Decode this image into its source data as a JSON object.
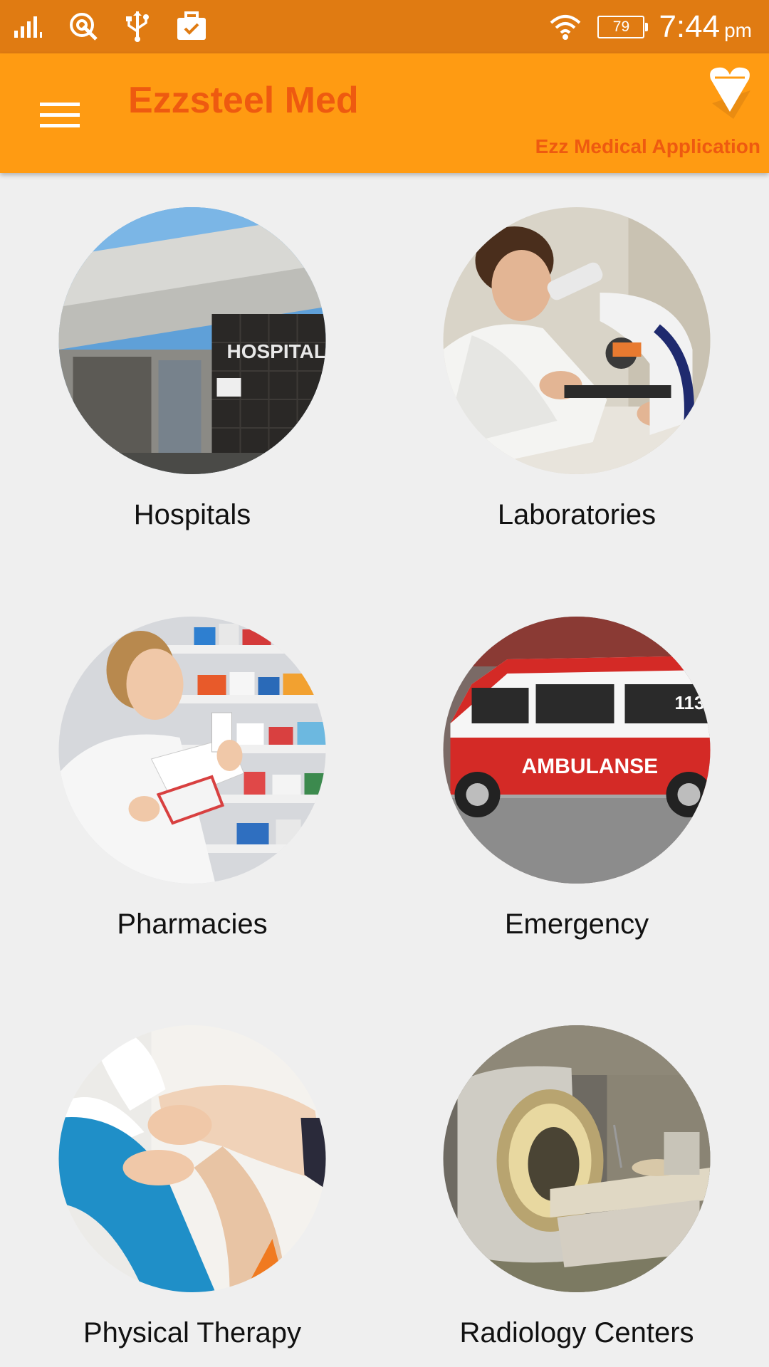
{
  "status_bar": {
    "battery": "79",
    "time": "7:44",
    "ampm": "pm",
    "icons": [
      "signal-icon",
      "location-icon",
      "usb-icon",
      "work-briefcase-icon",
      "wifi-icon",
      "battery-icon"
    ]
  },
  "app_bar": {
    "title": "Ezzsteel Med",
    "subtitle": "Ezz Medical Application",
    "menu_icon": "hamburger-icon",
    "logo_icon": "heart-logo-icon"
  },
  "categories": [
    {
      "label": "Hospitals",
      "icon": "hospital-image"
    },
    {
      "label": "Laboratories",
      "icon": "laboratory-image"
    },
    {
      "label": "Pharmacies",
      "icon": "pharmacy-image"
    },
    {
      "label": "Emergency",
      "icon": "ambulance-image"
    },
    {
      "label": "Physical Therapy",
      "icon": "physical-therapy-image"
    },
    {
      "label": "Radiology Centers",
      "icon": "radiology-image"
    }
  ],
  "images": {
    "hospital_sign": "HOSPITAL",
    "ambulance_text": "AMBULANSE",
    "ambulance_number": "113"
  },
  "colors": {
    "status_bar": "#e07b12",
    "app_bar": "#ff9b12",
    "title": "#ee5a10",
    "background": "#efefef"
  }
}
